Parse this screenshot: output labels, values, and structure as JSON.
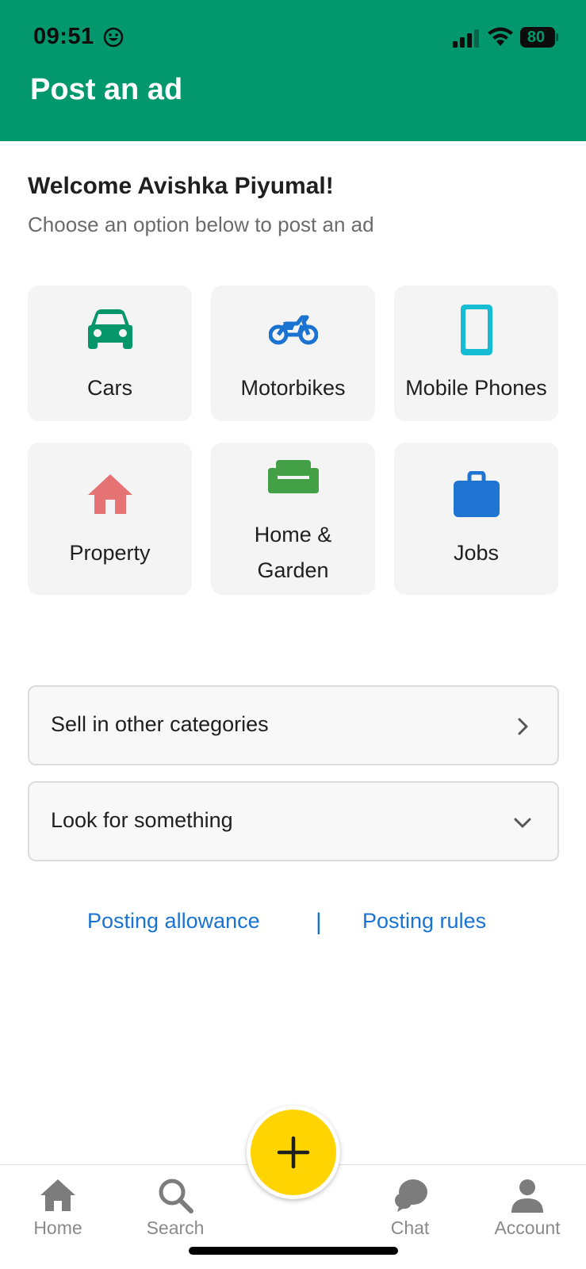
{
  "status_bar": {
    "time": "09:51",
    "battery": "80"
  },
  "header": {
    "title": "Post an ad"
  },
  "welcome": {
    "heading": "Welcome Avishka Piyumal!",
    "subtitle": "Choose an option below to post an ad"
  },
  "categories": [
    {
      "label": "Cars",
      "icon": "car-icon",
      "color": "#059669"
    },
    {
      "label": "Motorbikes",
      "icon": "motorbike-icon",
      "color": "#1a73d1"
    },
    {
      "label": "Mobile Phones",
      "icon": "mobile-phone-icon",
      "color": "#16bcd3"
    },
    {
      "label": "Property",
      "icon": "house-icon",
      "color": "#e57373"
    },
    {
      "label": "Home &",
      "label2": "Garden",
      "icon": "sofa-icon",
      "color": "#43a047"
    },
    {
      "label": "Jobs",
      "icon": "briefcase-icon",
      "color": "#1f73d1"
    }
  ],
  "actions": {
    "sell_other": {
      "label": "Sell in other categories",
      "icon": "chevron-right-icon"
    },
    "look_for": {
      "label": "Look for something",
      "icon": "chevron-down-icon"
    }
  },
  "links": {
    "allowance": "Posting allowance",
    "separator": "|",
    "rules": "Posting rules"
  },
  "bottom_nav": {
    "home": "Home",
    "search": "Search",
    "chat": "Chat",
    "account": "Account"
  },
  "colors": {
    "brand": "#02976c",
    "link": "#1a73d1",
    "fab": "#ffd400"
  }
}
